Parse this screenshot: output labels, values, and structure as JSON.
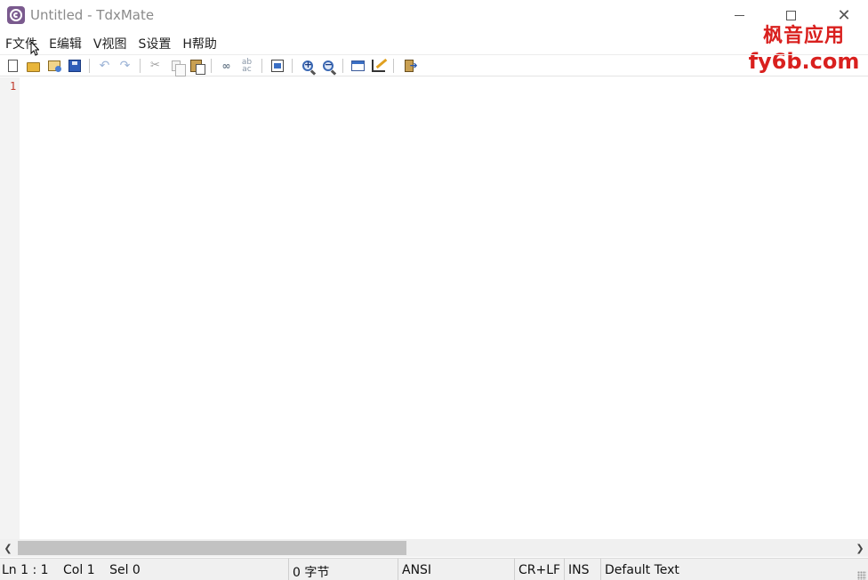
{
  "window": {
    "title": "Untitled - TdxMate"
  },
  "menu": {
    "items": [
      {
        "label": "F文件"
      },
      {
        "label": "E编辑"
      },
      {
        "label": "V视图"
      },
      {
        "label": "S设置"
      },
      {
        "label": "H帮助"
      }
    ]
  },
  "watermark": {
    "line1": "枫音应用",
    "line2": "fy6b.com",
    "color": "#d9201e"
  },
  "toolbar": {
    "icons": [
      "new-file-icon",
      "open-file-icon",
      "recent-files-icon",
      "save-icon",
      "undo-icon",
      "redo-icon",
      "cut-icon",
      "copy-icon",
      "paste-icon",
      "find-icon",
      "replace-icon",
      "properties-icon",
      "zoom-in-icon",
      "zoom-out-icon",
      "window-icon",
      "edit-scheme-icon",
      "exit-icon"
    ]
  },
  "editor": {
    "line_numbers": [
      "1"
    ],
    "line_number_color": "#c0392b"
  },
  "statusbar": {
    "ln": "Ln 1 : 1",
    "col": "Col 1",
    "sel": "Sel 0",
    "bytes": "0 字节",
    "encoding": "ANSI",
    "eol": "CR+LF",
    "insert_mode": "INS",
    "scheme": "Default Text"
  }
}
